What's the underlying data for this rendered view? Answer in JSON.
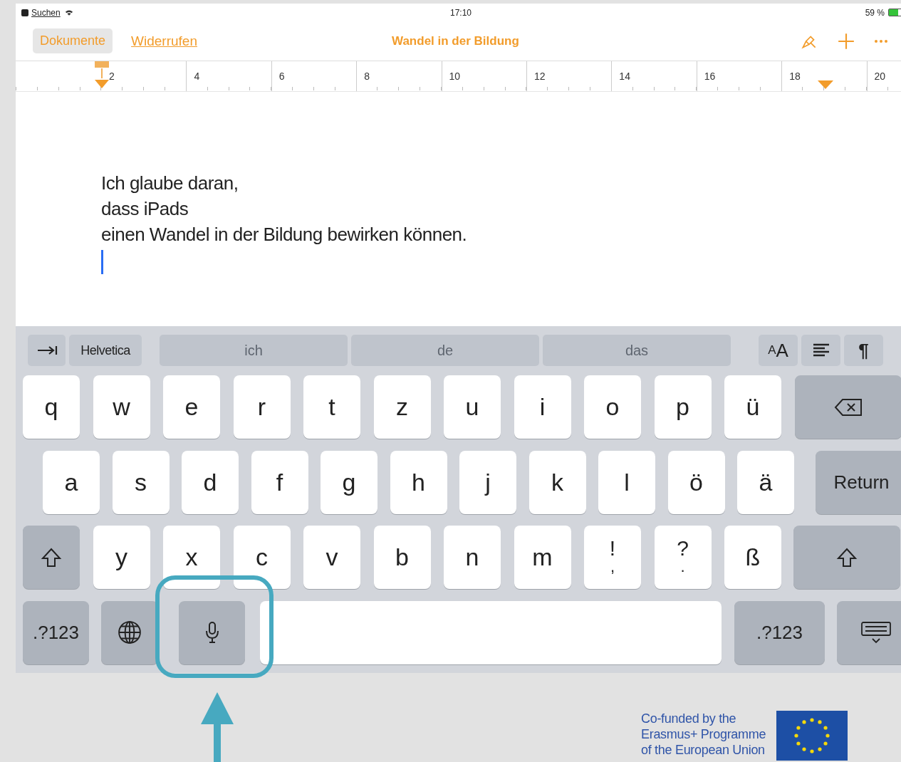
{
  "status_bar": {
    "back_label": "Suchen",
    "time": "17:10",
    "battery_text": "59 %"
  },
  "toolbar": {
    "documents_button": "Dokumente",
    "undo_link": "Widerrufen",
    "title": "Wandel in der Bildung"
  },
  "ruler": {
    "numbers": [
      "2",
      "4",
      "6",
      "8",
      "10",
      "12",
      "14",
      "16",
      "18",
      "20"
    ]
  },
  "document": {
    "lines": [
      "Ich glaube daran,",
      "dass iPads",
      "einen Wandel in der Bildung bewirken können."
    ]
  },
  "shortcut_bar": {
    "font_button": "Helvetica",
    "suggestions": [
      "ich",
      "de",
      "das"
    ],
    "text_size_label": "AA",
    "paragraph_label": "¶"
  },
  "keyboard": {
    "rows": [
      [
        {
          "kind": "char",
          "label": "q"
        },
        {
          "kind": "char",
          "label": "w"
        },
        {
          "kind": "char",
          "label": "e"
        },
        {
          "kind": "char",
          "label": "r"
        },
        {
          "kind": "char",
          "label": "t"
        },
        {
          "kind": "char",
          "label": "z"
        },
        {
          "kind": "char",
          "label": "u"
        },
        {
          "kind": "char",
          "label": "i"
        },
        {
          "kind": "char",
          "label": "o"
        },
        {
          "kind": "char",
          "label": "p"
        },
        {
          "kind": "char",
          "label": "ü"
        },
        {
          "kind": "delete"
        }
      ],
      [
        {
          "kind": "char",
          "label": "a"
        },
        {
          "kind": "char",
          "label": "s"
        },
        {
          "kind": "char",
          "label": "d"
        },
        {
          "kind": "char",
          "label": "f"
        },
        {
          "kind": "char",
          "label": "g"
        },
        {
          "kind": "char",
          "label": "h"
        },
        {
          "kind": "char",
          "label": "j"
        },
        {
          "kind": "char",
          "label": "k"
        },
        {
          "kind": "char",
          "label": "l"
        },
        {
          "kind": "char",
          "label": "ö"
        },
        {
          "kind": "char",
          "label": "ä"
        },
        {
          "kind": "return",
          "label": "Return"
        }
      ],
      [
        {
          "kind": "shift"
        },
        {
          "kind": "char",
          "label": "y"
        },
        {
          "kind": "char",
          "label": "x"
        },
        {
          "kind": "char",
          "label": "c"
        },
        {
          "kind": "char",
          "label": "v"
        },
        {
          "kind": "char",
          "label": "b"
        },
        {
          "kind": "char",
          "label": "n"
        },
        {
          "kind": "char",
          "label": "m"
        },
        {
          "kind": "dual",
          "label": "!",
          "sub": ","
        },
        {
          "kind": "dual",
          "label": "?",
          "sub": "."
        },
        {
          "kind": "char",
          "label": "ß"
        },
        {
          "kind": "shift"
        }
      ],
      [
        {
          "kind": "numbers",
          "label": ".?123"
        },
        {
          "kind": "globe"
        },
        {
          "kind": "mic"
        },
        {
          "kind": "space"
        },
        {
          "kind": "numbers",
          "label": ".?123"
        },
        {
          "kind": "hide"
        }
      ]
    ]
  },
  "footer": {
    "eu_text": [
      "Co-funded by the",
      "Erasmus+ Programme",
      "of the European Union"
    ]
  }
}
